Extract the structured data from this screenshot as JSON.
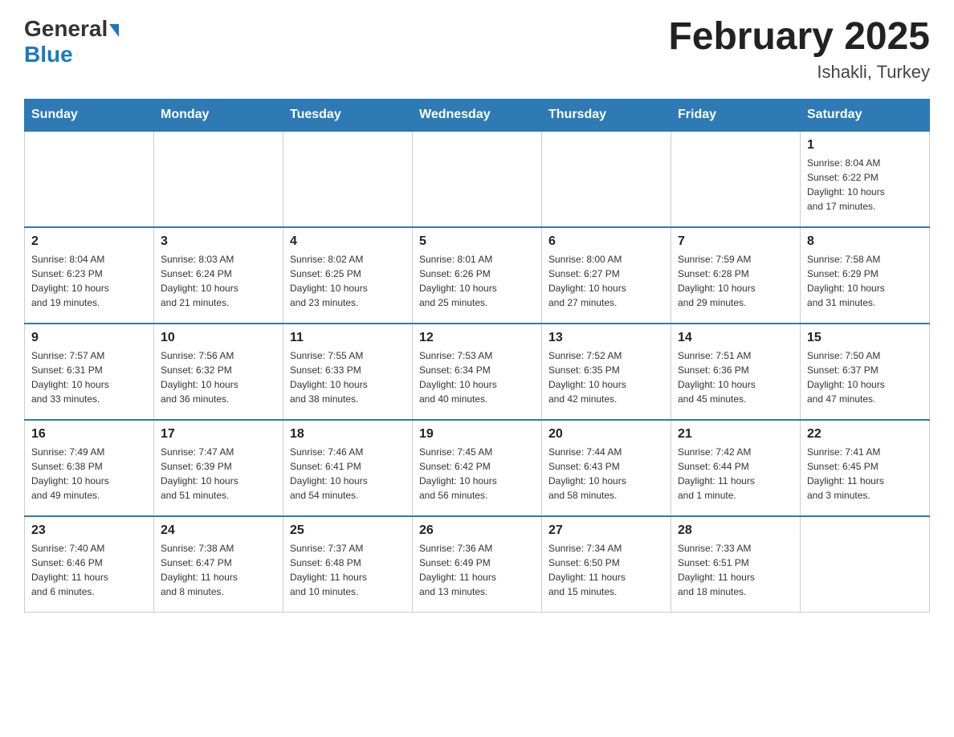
{
  "header": {
    "logo_general": "General",
    "logo_blue": "Blue",
    "month_title": "February 2025",
    "location": "Ishakli, Turkey"
  },
  "weekdays": [
    "Sunday",
    "Monday",
    "Tuesday",
    "Wednesday",
    "Thursday",
    "Friday",
    "Saturday"
  ],
  "weeks": [
    [
      {
        "day": "",
        "info": ""
      },
      {
        "day": "",
        "info": ""
      },
      {
        "day": "",
        "info": ""
      },
      {
        "day": "",
        "info": ""
      },
      {
        "day": "",
        "info": ""
      },
      {
        "day": "",
        "info": ""
      },
      {
        "day": "1",
        "info": "Sunrise: 8:04 AM\nSunset: 6:22 PM\nDaylight: 10 hours\nand 17 minutes."
      }
    ],
    [
      {
        "day": "2",
        "info": "Sunrise: 8:04 AM\nSunset: 6:23 PM\nDaylight: 10 hours\nand 19 minutes."
      },
      {
        "day": "3",
        "info": "Sunrise: 8:03 AM\nSunset: 6:24 PM\nDaylight: 10 hours\nand 21 minutes."
      },
      {
        "day": "4",
        "info": "Sunrise: 8:02 AM\nSunset: 6:25 PM\nDaylight: 10 hours\nand 23 minutes."
      },
      {
        "day": "5",
        "info": "Sunrise: 8:01 AM\nSunset: 6:26 PM\nDaylight: 10 hours\nand 25 minutes."
      },
      {
        "day": "6",
        "info": "Sunrise: 8:00 AM\nSunset: 6:27 PM\nDaylight: 10 hours\nand 27 minutes."
      },
      {
        "day": "7",
        "info": "Sunrise: 7:59 AM\nSunset: 6:28 PM\nDaylight: 10 hours\nand 29 minutes."
      },
      {
        "day": "8",
        "info": "Sunrise: 7:58 AM\nSunset: 6:29 PM\nDaylight: 10 hours\nand 31 minutes."
      }
    ],
    [
      {
        "day": "9",
        "info": "Sunrise: 7:57 AM\nSunset: 6:31 PM\nDaylight: 10 hours\nand 33 minutes."
      },
      {
        "day": "10",
        "info": "Sunrise: 7:56 AM\nSunset: 6:32 PM\nDaylight: 10 hours\nand 36 minutes."
      },
      {
        "day": "11",
        "info": "Sunrise: 7:55 AM\nSunset: 6:33 PM\nDaylight: 10 hours\nand 38 minutes."
      },
      {
        "day": "12",
        "info": "Sunrise: 7:53 AM\nSunset: 6:34 PM\nDaylight: 10 hours\nand 40 minutes."
      },
      {
        "day": "13",
        "info": "Sunrise: 7:52 AM\nSunset: 6:35 PM\nDaylight: 10 hours\nand 42 minutes."
      },
      {
        "day": "14",
        "info": "Sunrise: 7:51 AM\nSunset: 6:36 PM\nDaylight: 10 hours\nand 45 minutes."
      },
      {
        "day": "15",
        "info": "Sunrise: 7:50 AM\nSunset: 6:37 PM\nDaylight: 10 hours\nand 47 minutes."
      }
    ],
    [
      {
        "day": "16",
        "info": "Sunrise: 7:49 AM\nSunset: 6:38 PM\nDaylight: 10 hours\nand 49 minutes."
      },
      {
        "day": "17",
        "info": "Sunrise: 7:47 AM\nSunset: 6:39 PM\nDaylight: 10 hours\nand 51 minutes."
      },
      {
        "day": "18",
        "info": "Sunrise: 7:46 AM\nSunset: 6:41 PM\nDaylight: 10 hours\nand 54 minutes."
      },
      {
        "day": "19",
        "info": "Sunrise: 7:45 AM\nSunset: 6:42 PM\nDaylight: 10 hours\nand 56 minutes."
      },
      {
        "day": "20",
        "info": "Sunrise: 7:44 AM\nSunset: 6:43 PM\nDaylight: 10 hours\nand 58 minutes."
      },
      {
        "day": "21",
        "info": "Sunrise: 7:42 AM\nSunset: 6:44 PM\nDaylight: 11 hours\nand 1 minute."
      },
      {
        "day": "22",
        "info": "Sunrise: 7:41 AM\nSunset: 6:45 PM\nDaylight: 11 hours\nand 3 minutes."
      }
    ],
    [
      {
        "day": "23",
        "info": "Sunrise: 7:40 AM\nSunset: 6:46 PM\nDaylight: 11 hours\nand 6 minutes."
      },
      {
        "day": "24",
        "info": "Sunrise: 7:38 AM\nSunset: 6:47 PM\nDaylight: 11 hours\nand 8 minutes."
      },
      {
        "day": "25",
        "info": "Sunrise: 7:37 AM\nSunset: 6:48 PM\nDaylight: 11 hours\nand 10 minutes."
      },
      {
        "day": "26",
        "info": "Sunrise: 7:36 AM\nSunset: 6:49 PM\nDaylight: 11 hours\nand 13 minutes."
      },
      {
        "day": "27",
        "info": "Sunrise: 7:34 AM\nSunset: 6:50 PM\nDaylight: 11 hours\nand 15 minutes."
      },
      {
        "day": "28",
        "info": "Sunrise: 7:33 AM\nSunset: 6:51 PM\nDaylight: 11 hours\nand 18 minutes."
      },
      {
        "day": "",
        "info": ""
      }
    ]
  ]
}
